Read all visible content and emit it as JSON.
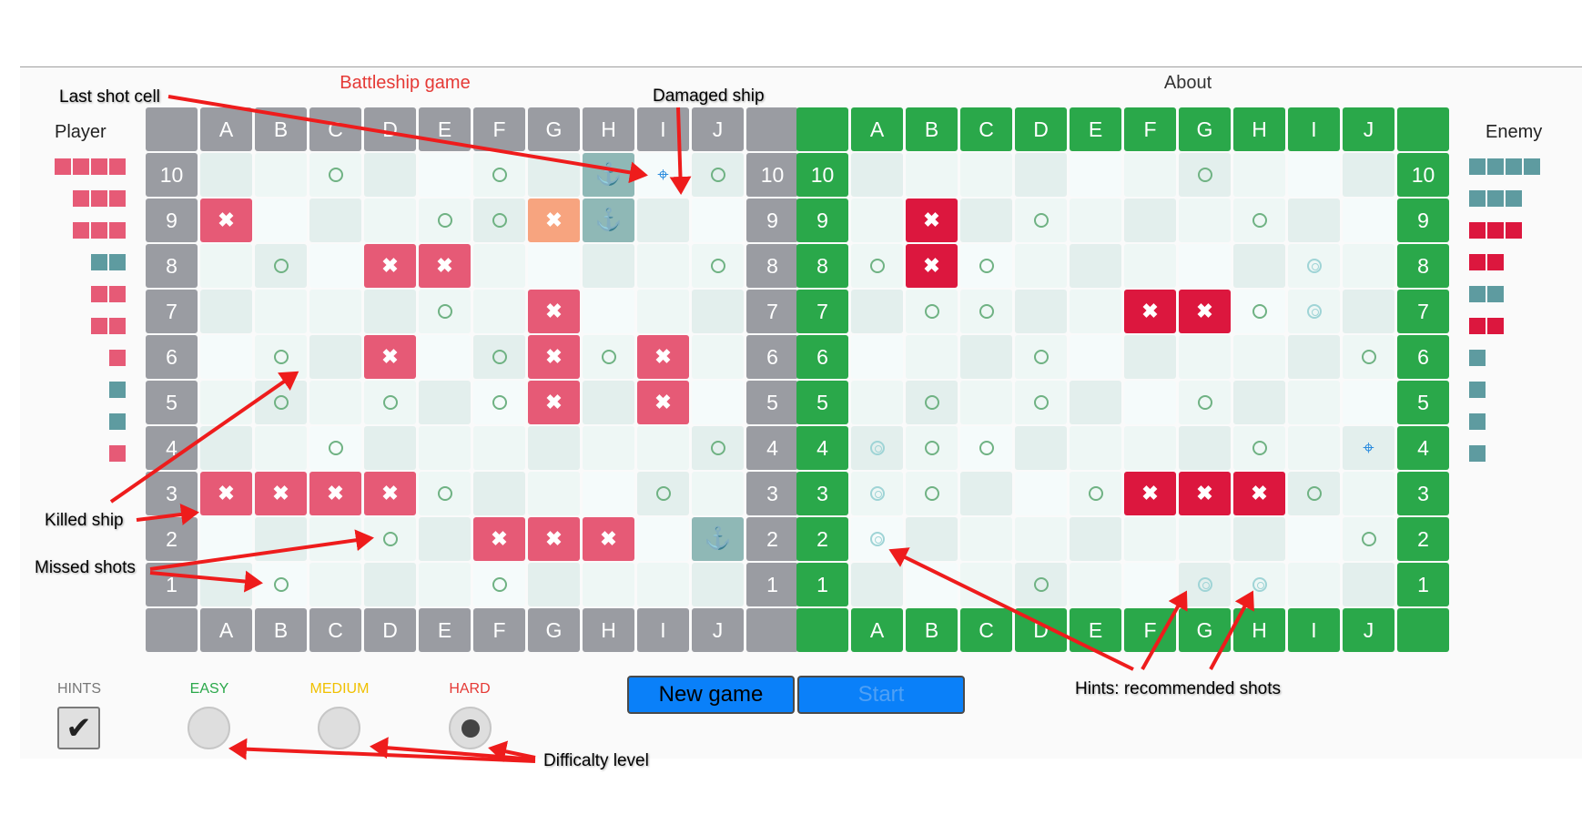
{
  "menu": {
    "game_link": "Battleship game",
    "about_link": "About",
    "game_color": "#e53935",
    "about_color": "#333333"
  },
  "player_label": "Player",
  "enemy_label": "Enemy",
  "columns": [
    "A",
    "B",
    "C",
    "D",
    "E",
    "F",
    "G",
    "H",
    "I",
    "J"
  ],
  "rows": [
    "10",
    "9",
    "8",
    "7",
    "6",
    "5",
    "4",
    "3",
    "2",
    "1"
  ],
  "player_board": {
    "cells": [
      "  m  m ^tm",
      "x   mmdS  ",
      " m xx    m",
      "    m x   ",
      " m x mxmx ",
      " m m mx x ",
      "  m      m",
      "xxxxm   m ",
      "   m xxx S",
      " m   m    "
    ]
  },
  "enemy_board": {
    "cells": [
      "      m   ",
      " x m   m  ",
      "mxm     h ",
      " mm  xxmh ",
      "   m     m",
      " m m  m   ",
      "hmm    m t",
      "hm  mxxxm ",
      "h        m",
      "   m  hh  "
    ]
  },
  "player_fleet": [
    {
      "size": 4,
      "state": "hit"
    },
    {
      "size": 3,
      "state": "hit"
    },
    {
      "size": 3,
      "state": "hit"
    },
    {
      "size": 2,
      "state": "alive"
    },
    {
      "size": 2,
      "state": "hit"
    },
    {
      "size": 2,
      "state": "hit"
    },
    {
      "size": 1,
      "state": "hit"
    },
    {
      "size": 1,
      "state": "alive"
    },
    {
      "size": 1,
      "state": "alive"
    },
    {
      "size": 1,
      "state": "hit"
    }
  ],
  "enemy_fleet": [
    {
      "size": 4,
      "state": "alive"
    },
    {
      "size": 3,
      "state": "alive"
    },
    {
      "size": 3,
      "state": "hit"
    },
    {
      "size": 2,
      "state": "hit"
    },
    {
      "size": 2,
      "state": "alive"
    },
    {
      "size": 2,
      "state": "hit"
    },
    {
      "size": 1,
      "state": "alive"
    },
    {
      "size": 1,
      "state": "alive"
    },
    {
      "size": 1,
      "state": "alive"
    },
    {
      "size": 1,
      "state": "alive"
    }
  ],
  "colors": {
    "player_hit": "#e65a76",
    "enemy_hit": "#dc173e",
    "alive_ship": "#5e9ba0",
    "header_gray": "#9a9ca2",
    "header_green": "#2aa84a"
  },
  "controls": {
    "hints_label": "HINTS",
    "hints_checked": true,
    "easy_label": "EASY",
    "medium_label": "MEDIUM",
    "hard_label": "HARD",
    "selected_level": "HARD",
    "easy_color": "#2aa84a",
    "medium_color": "#f0c000",
    "hard_color": "#e53935",
    "hints_color": "#777777",
    "new_game_label": "New game",
    "start_label": "Start"
  },
  "annotations": {
    "last_shot_cell": "Last shot cell",
    "damaged_ship": "Damaged ship",
    "killed_ship": "Killed ship",
    "missed_shots": "Missed shots",
    "hints_recommended": "Hints: recommended shots",
    "difficulty_level": "Difficalty level"
  }
}
